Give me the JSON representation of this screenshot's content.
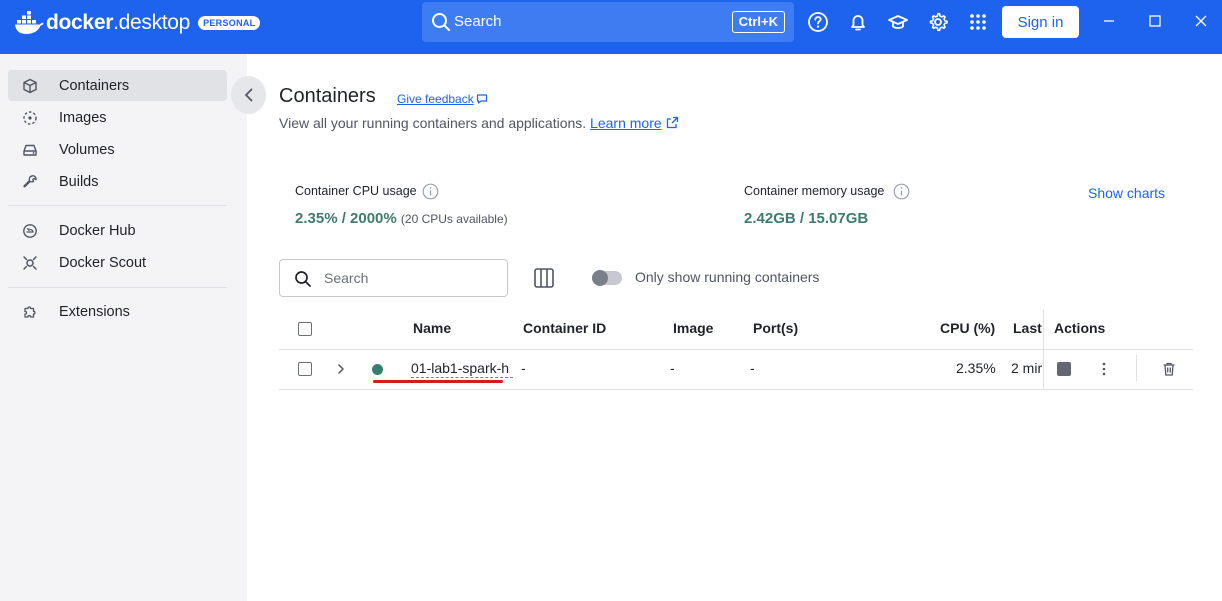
{
  "app": {
    "logo_bold": "docker",
    "logo_light": ".desktop",
    "badge": "PERSONAL",
    "search_label": "Search",
    "search_shortcut": "Ctrl+K",
    "signin_label": "Sign in",
    "brand_color": "#1d63ed"
  },
  "sidebar": {
    "items": [
      {
        "label": "Containers",
        "icon": "container-icon",
        "active": true
      },
      {
        "label": "Images",
        "icon": "images-icon"
      },
      {
        "label": "Volumes",
        "icon": "volumes-icon"
      },
      {
        "label": "Builds",
        "icon": "wrench-icon"
      },
      {
        "label": "Docker Hub",
        "icon": "docker-hub-icon"
      },
      {
        "label": "Docker Scout",
        "icon": "docker-scout-icon"
      },
      {
        "label": "Extensions",
        "icon": "puzzle-icon"
      }
    ]
  },
  "main": {
    "title": "Containers",
    "feedback_label": "Give feedback",
    "subtitle": "View all your running containers and applications.",
    "learn_more": "Learn more",
    "cpu_label": "Container CPU usage",
    "cpu_value": "2.35% / 2000%",
    "cpu_sub": "(20 CPUs available)",
    "mem_label": "Container memory usage",
    "mem_value": "2.42GB / 15.07GB",
    "show_charts": "Show charts",
    "search_placeholder": "Search",
    "toggle_label": "Only show running containers",
    "toggle_on": false
  },
  "table": {
    "headers": {
      "name": "Name",
      "container_id": "Container ID",
      "image": "Image",
      "ports": "Port(s)",
      "cpu": "CPU (%)",
      "last": "Last",
      "actions": "Actions"
    },
    "rows": [
      {
        "name": "01-lab1-spark-h",
        "container_id": "-",
        "image": "-",
        "ports": "-",
        "cpu": "2.35%",
        "last": "2 mir",
        "status_color": "#357e6e"
      }
    ]
  }
}
